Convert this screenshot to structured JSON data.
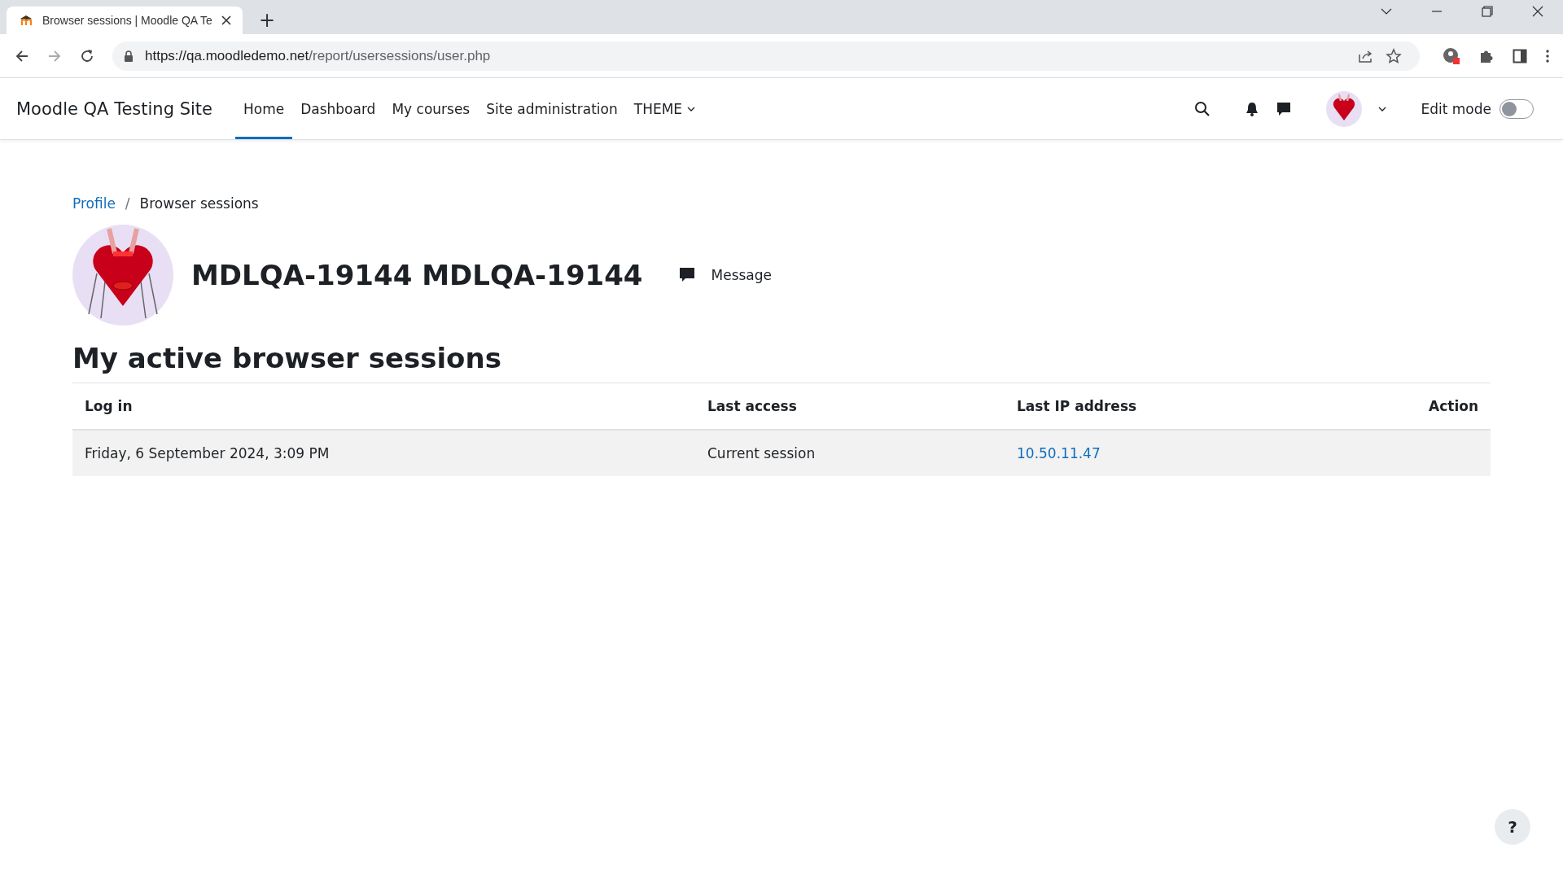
{
  "browser": {
    "tabs": [
      {
        "title": "Browser sessions | Moodle QA Te",
        "selected": true
      }
    ],
    "new_tab": "+",
    "url_host": "https://qa.moodledemo.net",
    "url_path": "/report/usersessions/user.php"
  },
  "navbar": {
    "site_name": "Moodle QA Testing Site",
    "items": [
      {
        "label": "Home",
        "selected": true,
        "kind": "link"
      },
      {
        "label": "Dashboard",
        "selected": false,
        "kind": "link"
      },
      {
        "label": "My courses",
        "selected": false,
        "kind": "link"
      },
      {
        "label": "Site administration",
        "selected": false,
        "kind": "link"
      },
      {
        "label": "THEME",
        "selected": false,
        "kind": "dropdown"
      }
    ],
    "edit_mode": {
      "label": "Edit mode",
      "on": false
    }
  },
  "breadcrumb": [
    {
      "label": "Profile",
      "kind": "link"
    },
    {
      "label": "Browser sessions",
      "kind": "current"
    }
  ],
  "breadcrumb_separator": "/",
  "profile": {
    "name": "MDLQA-19144 MDLQA-19144",
    "message_button": "Message"
  },
  "heading": "My active browser sessions",
  "table": {
    "columns": [
      "Log in",
      "Last access",
      "Last IP address",
      "Action"
    ],
    "rows": [
      {
        "log_in": "Friday, 6 September 2024, 3:09 PM",
        "last_access": "Current session",
        "last_ip": "10.50.11.47"
      }
    ]
  },
  "help_button": "?"
}
